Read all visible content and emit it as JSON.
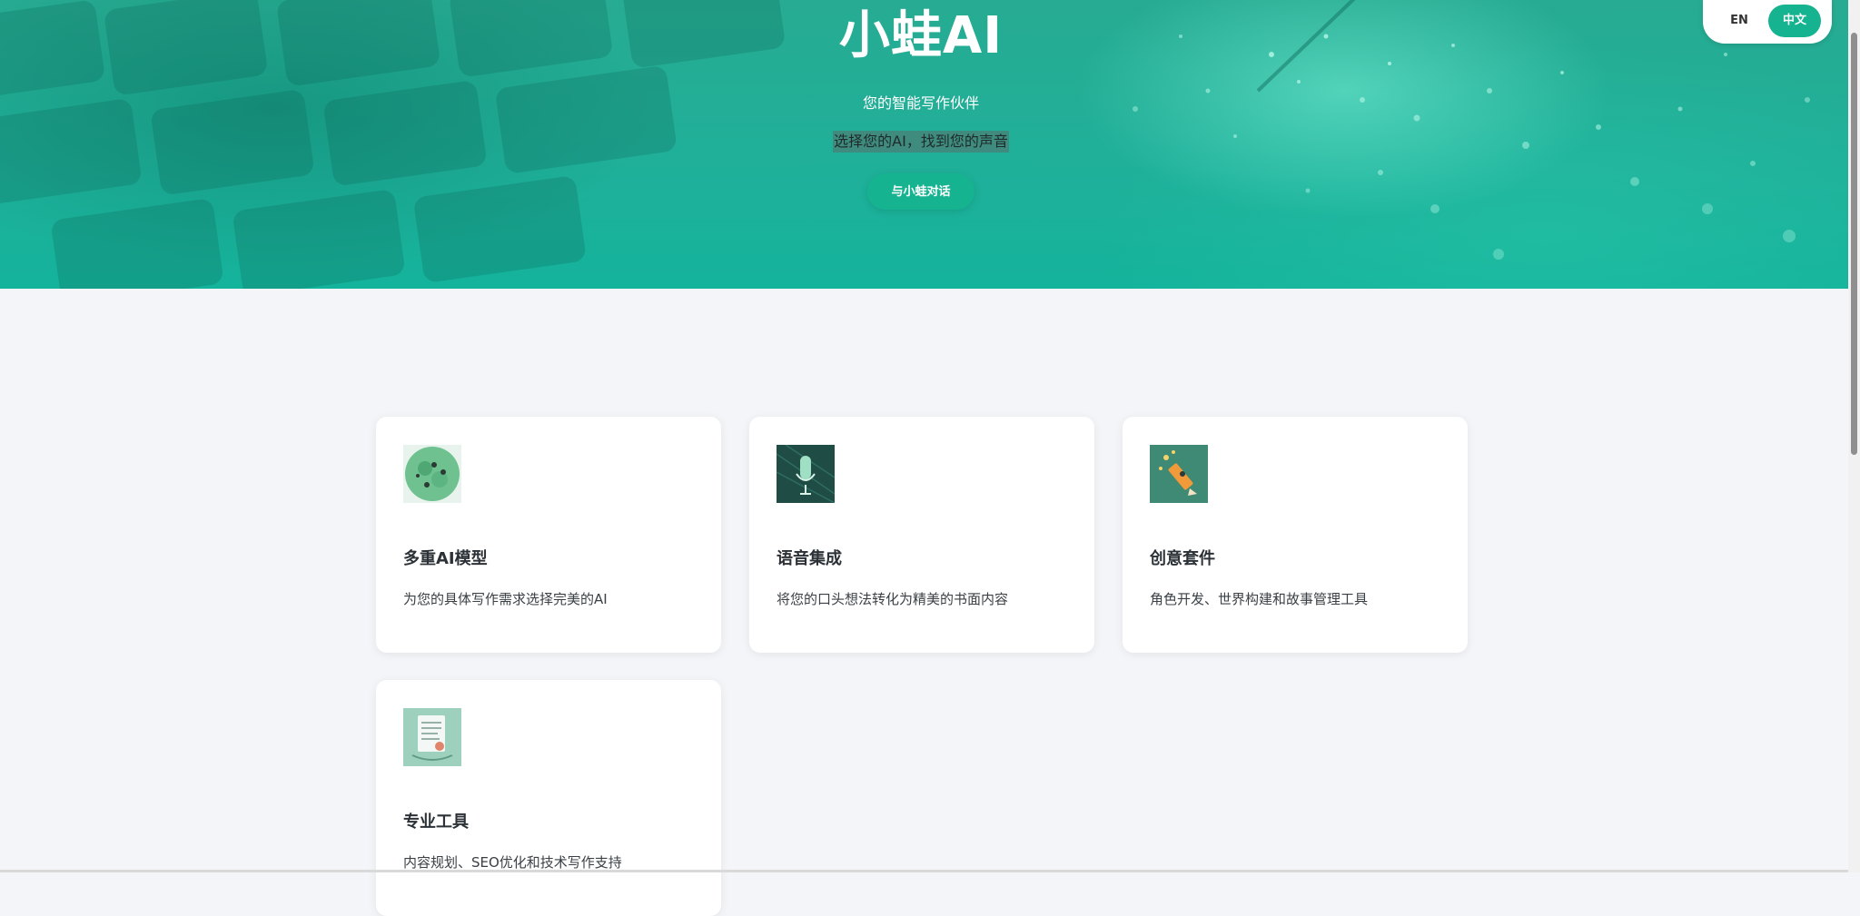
{
  "hero": {
    "title": "小蛙AI",
    "subtitle": "您的智能写作伙伴",
    "tagline": "选择您的AI，找到您的声音",
    "cta_label": "与小蛙对话"
  },
  "language": {
    "en_label": "EN",
    "zh_label": "中文",
    "selected": "中文"
  },
  "features": [
    {
      "title": "多重AI模型",
      "description": "为您的具体写作需求选择完美的AI",
      "icon": "frog-globe-icon"
    },
    {
      "title": "语音集成",
      "description": "将您的口头想法转化为精美的书面内容",
      "icon": "microphone-icon"
    },
    {
      "title": "创意套件",
      "description": "角色开发、世界构建和故事管理工具",
      "icon": "pencil-sparkle-icon"
    },
    {
      "title": "专业工具",
      "description": "内容规划、SEO优化和技术写作支持",
      "icon": "document-icon"
    }
  ],
  "colors": {
    "accent": "#16b391",
    "hero_bg": "#1fb09a",
    "page_bg": "#f4f5f8"
  }
}
